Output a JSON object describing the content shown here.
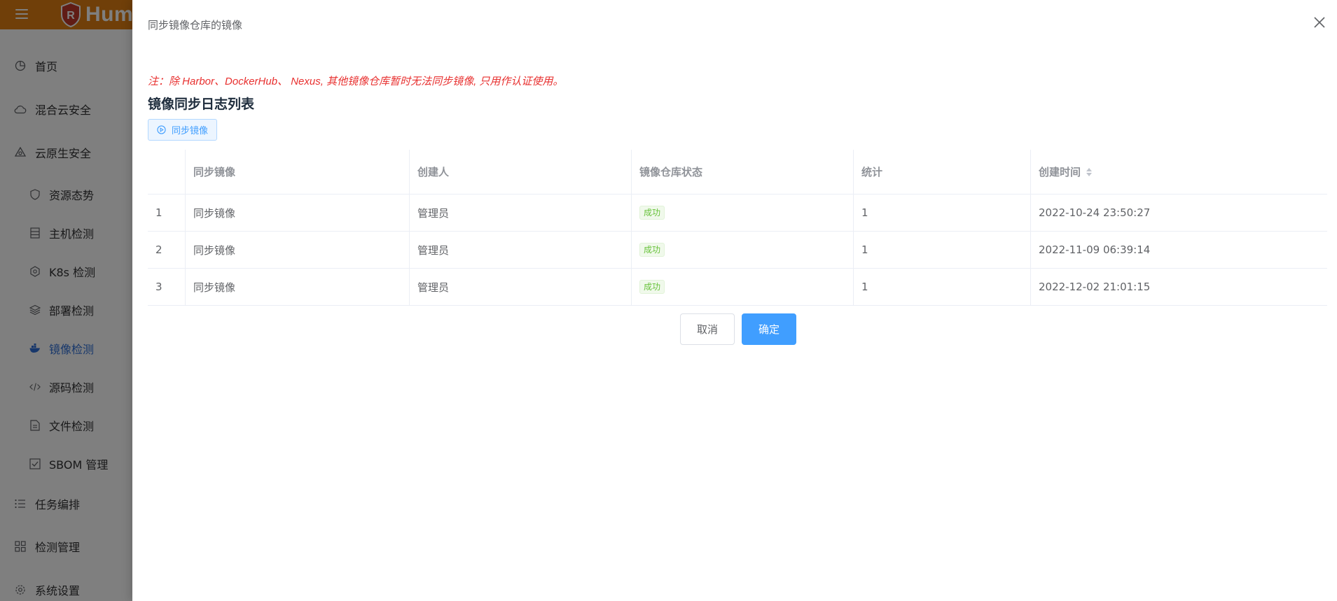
{
  "app": {
    "logo_text": "Humm",
    "brand_color": "#e07f12"
  },
  "sidebar": {
    "items": [
      {
        "label": "首页",
        "icon": "dashboard-icon"
      },
      {
        "label": "混合云安全",
        "icon": "cloud-icon"
      },
      {
        "label": "云原生安全",
        "icon": "cloud-native-icon"
      },
      {
        "label": "资源态势",
        "icon": "shield-icon"
      },
      {
        "label": "主机检测",
        "icon": "host-icon"
      },
      {
        "label": "K8s 检测",
        "icon": "kubernetes-icon"
      },
      {
        "label": "部署检测",
        "icon": "layers-icon"
      },
      {
        "label": "镜像检测",
        "icon": "docker-icon"
      },
      {
        "label": "源码检测",
        "icon": "code-icon"
      },
      {
        "label": "文件检测",
        "icon": "file-icon"
      },
      {
        "label": "SBOM 管理",
        "icon": "checkbox-icon"
      },
      {
        "label": "任务编排",
        "icon": "list-icon"
      },
      {
        "label": "检测管理",
        "icon": "grid-icon"
      },
      {
        "label": "系统设置",
        "icon": "gear-icon"
      }
    ]
  },
  "drawer": {
    "title": "同步镜像仓库的镜像",
    "note": "注：除 Harbor、DockerHub、 Nexus, 其他镜像仓库暂时无法同步镜像, 只用作认证使用。",
    "note_color": "#e8302f",
    "section_title": "镜像同步日志列表",
    "sync_button": "同步镜像",
    "table": {
      "headers": [
        "",
        "同步镜像",
        "创建人",
        "镜像仓库状态",
        "统计",
        "创建时间"
      ],
      "rows": [
        {
          "index": "1",
          "name": "同步镜像",
          "creator": "管理员",
          "status": "成功",
          "count": "1",
          "created": "2022-10-24 23:50:27"
        },
        {
          "index": "2",
          "name": "同步镜像",
          "creator": "管理员",
          "status": "成功",
          "count": "1",
          "created": "2022-11-09 06:39:14"
        },
        {
          "index": "3",
          "name": "同步镜像",
          "creator": "管理员",
          "status": "成功",
          "count": "1",
          "created": "2022-12-02 21:01:15"
        }
      ]
    },
    "cancel_label": "取消",
    "confirm_label": "确定",
    "primary_color": "#409eff",
    "success_color": "#67c23a"
  }
}
